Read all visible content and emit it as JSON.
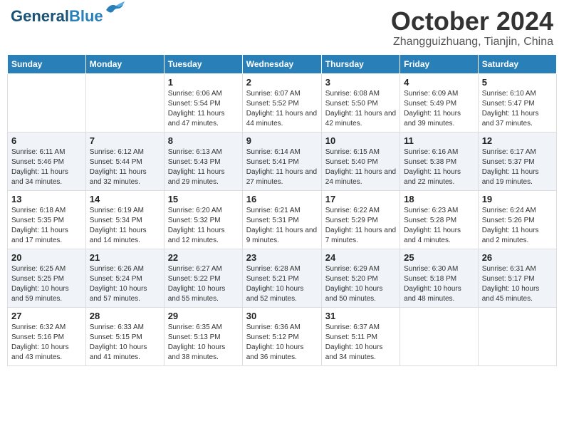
{
  "header": {
    "logo_general": "General",
    "logo_blue": "Blue",
    "month": "October 2024",
    "location": "Zhangguizhuang, Tianjin, China"
  },
  "weekdays": [
    "Sunday",
    "Monday",
    "Tuesday",
    "Wednesday",
    "Thursday",
    "Friday",
    "Saturday"
  ],
  "weeks": [
    [
      {
        "day": "",
        "sunrise": "",
        "sunset": "",
        "daylight": ""
      },
      {
        "day": "",
        "sunrise": "",
        "sunset": "",
        "daylight": ""
      },
      {
        "day": "1",
        "sunrise": "Sunrise: 6:06 AM",
        "sunset": "Sunset: 5:54 PM",
        "daylight": "Daylight: 11 hours and 47 minutes."
      },
      {
        "day": "2",
        "sunrise": "Sunrise: 6:07 AM",
        "sunset": "Sunset: 5:52 PM",
        "daylight": "Daylight: 11 hours and 44 minutes."
      },
      {
        "day": "3",
        "sunrise": "Sunrise: 6:08 AM",
        "sunset": "Sunset: 5:50 PM",
        "daylight": "Daylight: 11 hours and 42 minutes."
      },
      {
        "day": "4",
        "sunrise": "Sunrise: 6:09 AM",
        "sunset": "Sunset: 5:49 PM",
        "daylight": "Daylight: 11 hours and 39 minutes."
      },
      {
        "day": "5",
        "sunrise": "Sunrise: 6:10 AM",
        "sunset": "Sunset: 5:47 PM",
        "daylight": "Daylight: 11 hours and 37 minutes."
      }
    ],
    [
      {
        "day": "6",
        "sunrise": "Sunrise: 6:11 AM",
        "sunset": "Sunset: 5:46 PM",
        "daylight": "Daylight: 11 hours and 34 minutes."
      },
      {
        "day": "7",
        "sunrise": "Sunrise: 6:12 AM",
        "sunset": "Sunset: 5:44 PM",
        "daylight": "Daylight: 11 hours and 32 minutes."
      },
      {
        "day": "8",
        "sunrise": "Sunrise: 6:13 AM",
        "sunset": "Sunset: 5:43 PM",
        "daylight": "Daylight: 11 hours and 29 minutes."
      },
      {
        "day": "9",
        "sunrise": "Sunrise: 6:14 AM",
        "sunset": "Sunset: 5:41 PM",
        "daylight": "Daylight: 11 hours and 27 minutes."
      },
      {
        "day": "10",
        "sunrise": "Sunrise: 6:15 AM",
        "sunset": "Sunset: 5:40 PM",
        "daylight": "Daylight: 11 hours and 24 minutes."
      },
      {
        "day": "11",
        "sunrise": "Sunrise: 6:16 AM",
        "sunset": "Sunset: 5:38 PM",
        "daylight": "Daylight: 11 hours and 22 minutes."
      },
      {
        "day": "12",
        "sunrise": "Sunrise: 6:17 AM",
        "sunset": "Sunset: 5:37 PM",
        "daylight": "Daylight: 11 hours and 19 minutes."
      }
    ],
    [
      {
        "day": "13",
        "sunrise": "Sunrise: 6:18 AM",
        "sunset": "Sunset: 5:35 PM",
        "daylight": "Daylight: 11 hours and 17 minutes."
      },
      {
        "day": "14",
        "sunrise": "Sunrise: 6:19 AM",
        "sunset": "Sunset: 5:34 PM",
        "daylight": "Daylight: 11 hours and 14 minutes."
      },
      {
        "day": "15",
        "sunrise": "Sunrise: 6:20 AM",
        "sunset": "Sunset: 5:32 PM",
        "daylight": "Daylight: 11 hours and 12 minutes."
      },
      {
        "day": "16",
        "sunrise": "Sunrise: 6:21 AM",
        "sunset": "Sunset: 5:31 PM",
        "daylight": "Daylight: 11 hours and 9 minutes."
      },
      {
        "day": "17",
        "sunrise": "Sunrise: 6:22 AM",
        "sunset": "Sunset: 5:29 PM",
        "daylight": "Daylight: 11 hours and 7 minutes."
      },
      {
        "day": "18",
        "sunrise": "Sunrise: 6:23 AM",
        "sunset": "Sunset: 5:28 PM",
        "daylight": "Daylight: 11 hours and 4 minutes."
      },
      {
        "day": "19",
        "sunrise": "Sunrise: 6:24 AM",
        "sunset": "Sunset: 5:26 PM",
        "daylight": "Daylight: 11 hours and 2 minutes."
      }
    ],
    [
      {
        "day": "20",
        "sunrise": "Sunrise: 6:25 AM",
        "sunset": "Sunset: 5:25 PM",
        "daylight": "Daylight: 10 hours and 59 minutes."
      },
      {
        "day": "21",
        "sunrise": "Sunrise: 6:26 AM",
        "sunset": "Sunset: 5:24 PM",
        "daylight": "Daylight: 10 hours and 57 minutes."
      },
      {
        "day": "22",
        "sunrise": "Sunrise: 6:27 AM",
        "sunset": "Sunset: 5:22 PM",
        "daylight": "Daylight: 10 hours and 55 minutes."
      },
      {
        "day": "23",
        "sunrise": "Sunrise: 6:28 AM",
        "sunset": "Sunset: 5:21 PM",
        "daylight": "Daylight: 10 hours and 52 minutes."
      },
      {
        "day": "24",
        "sunrise": "Sunrise: 6:29 AM",
        "sunset": "Sunset: 5:20 PM",
        "daylight": "Daylight: 10 hours and 50 minutes."
      },
      {
        "day": "25",
        "sunrise": "Sunrise: 6:30 AM",
        "sunset": "Sunset: 5:18 PM",
        "daylight": "Daylight: 10 hours and 48 minutes."
      },
      {
        "day": "26",
        "sunrise": "Sunrise: 6:31 AM",
        "sunset": "Sunset: 5:17 PM",
        "daylight": "Daylight: 10 hours and 45 minutes."
      }
    ],
    [
      {
        "day": "27",
        "sunrise": "Sunrise: 6:32 AM",
        "sunset": "Sunset: 5:16 PM",
        "daylight": "Daylight: 10 hours and 43 minutes."
      },
      {
        "day": "28",
        "sunrise": "Sunrise: 6:33 AM",
        "sunset": "Sunset: 5:15 PM",
        "daylight": "Daylight: 10 hours and 41 minutes."
      },
      {
        "day": "29",
        "sunrise": "Sunrise: 6:35 AM",
        "sunset": "Sunset: 5:13 PM",
        "daylight": "Daylight: 10 hours and 38 minutes."
      },
      {
        "day": "30",
        "sunrise": "Sunrise: 6:36 AM",
        "sunset": "Sunset: 5:12 PM",
        "daylight": "Daylight: 10 hours and 36 minutes."
      },
      {
        "day": "31",
        "sunrise": "Sunrise: 6:37 AM",
        "sunset": "Sunset: 5:11 PM",
        "daylight": "Daylight: 10 hours and 34 minutes."
      },
      {
        "day": "",
        "sunrise": "",
        "sunset": "",
        "daylight": ""
      },
      {
        "day": "",
        "sunrise": "",
        "sunset": "",
        "daylight": ""
      }
    ]
  ]
}
